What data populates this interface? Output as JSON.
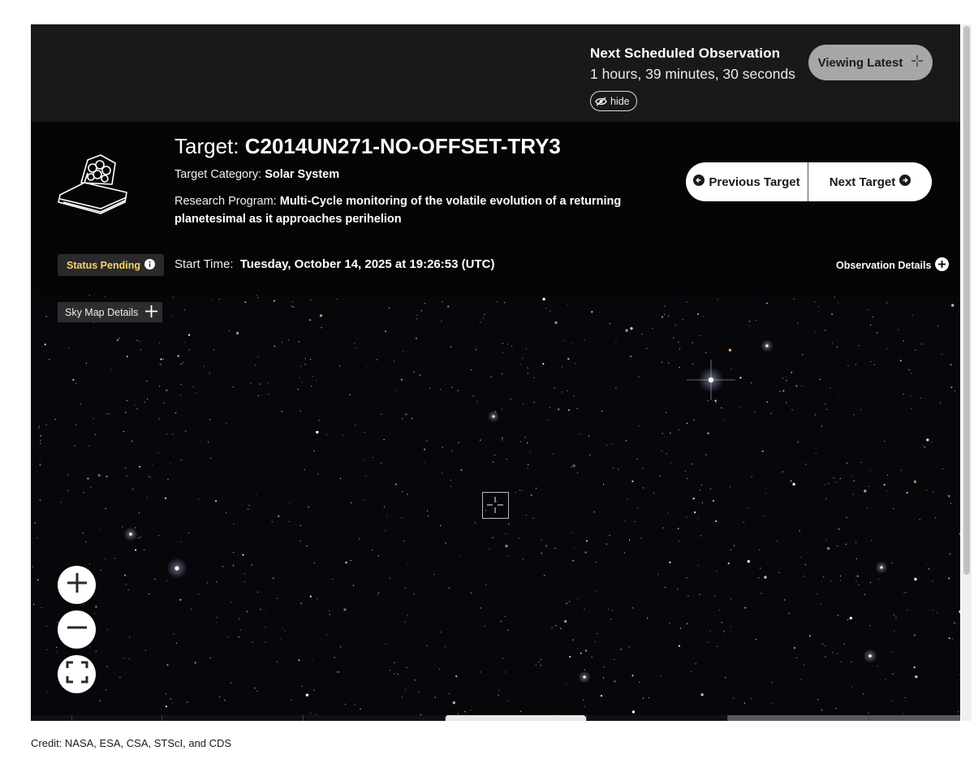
{
  "header": {
    "next_obs_title": "Next Scheduled Observation",
    "countdown": "1 hours, 39 minutes, 30 seconds",
    "hide_label": "hide",
    "viewing_latest_label": "Viewing Latest"
  },
  "target": {
    "title_label": "Target:",
    "name": "C2014UN271-NO-OFFSET-TRY3",
    "category_label": "Target Category:",
    "category": "Solar System",
    "program_label": "Research Program:",
    "program": "Multi-Cycle monitoring of the volatile evolution of a returning planetesimal as it approaches perihelion",
    "start_label": "Start Time:",
    "start_time": "Tuesday, October 14, 2025 at 19:26:53 (UTC)",
    "status": "Status Pending",
    "observation_details_label": "Observation Details"
  },
  "nav": {
    "previous_label": "Previous Target",
    "next_label": "Next Target"
  },
  "skymap": {
    "details_label": "Sky Map Details",
    "controls": [
      "zoom-in-icon",
      "zoom-out-icon",
      "fullscreen-icon"
    ]
  },
  "colors": {
    "status_text": "#f6d36b",
    "topbar_bg": "#19191b",
    "panel_bg": "#050505",
    "viewing_latest_bg": "#a7a7a9"
  },
  "credit": "Credit: NASA, ESA, CSA, STScI, and CDS"
}
